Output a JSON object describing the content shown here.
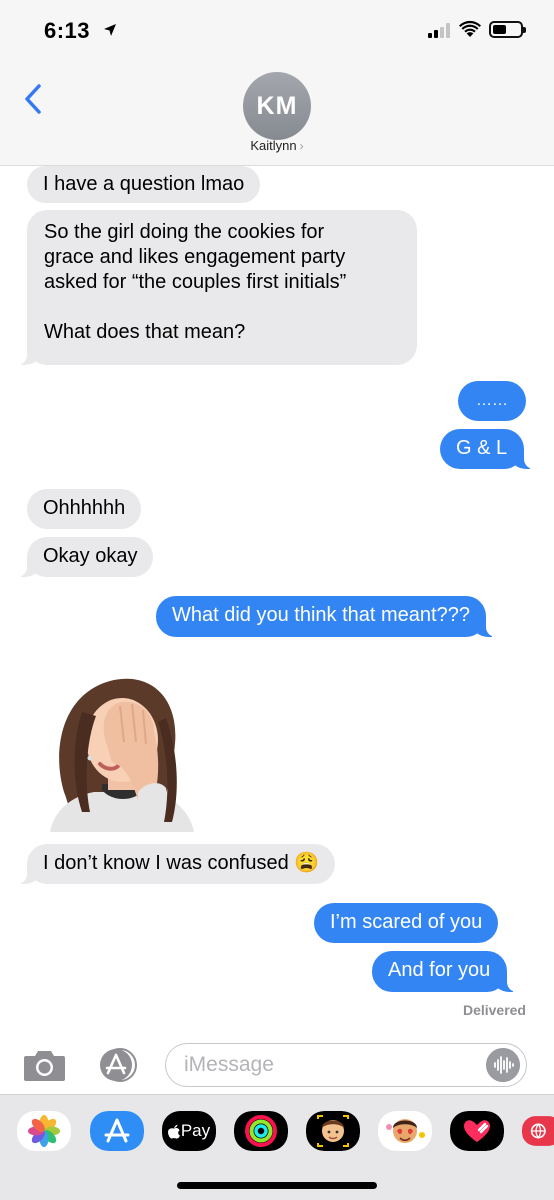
{
  "status_bar": {
    "time": "6:13"
  },
  "header": {
    "avatar_initials": "KM",
    "contact_name": "Kaitlynn",
    "chevron": "›"
  },
  "messages": [
    {
      "from": "them",
      "text": "I have a question lmao"
    },
    {
      "from": "them",
      "lines": [
        "So the girl doing the cookies for",
        "grace and likes engagement party",
        "asked for “the couples first initials”",
        "",
        "What does that mean?"
      ]
    },
    {
      "from": "me",
      "text": "……"
    },
    {
      "from": "me",
      "text": "G & L"
    },
    {
      "from": "them",
      "text": "Ohhhhhh"
    },
    {
      "from": "them",
      "text": "Okay okay"
    },
    {
      "from": "me",
      "text": "What did you think that meant???"
    },
    {
      "from": "them",
      "type": "memoji-sticker",
      "icon": "facepalm-memoji"
    },
    {
      "from": "them",
      "text": "I don’t know I was confused 😩"
    },
    {
      "from": "me",
      "text": "I’m scared of you"
    },
    {
      "from": "me",
      "text": "And for you"
    }
  ],
  "delivered_label": "Delivered",
  "composer": {
    "placeholder": "iMessage"
  },
  "app_drawer": [
    {
      "name": "photos",
      "icon": "photos-icon"
    },
    {
      "name": "app-store",
      "icon": "app-store-icon"
    },
    {
      "name": "apple-pay",
      "label": "Pay",
      "icon": "apple-pay-icon"
    },
    {
      "name": "activity",
      "icon": "activity-rings-icon"
    },
    {
      "name": "memoji",
      "icon": "memoji-icon"
    },
    {
      "name": "memoji-stickers",
      "icon": "memoji-stickers-icon"
    },
    {
      "name": "digital-touch",
      "icon": "heart-touch-icon"
    },
    {
      "name": "web-search",
      "icon": "globe-search-icon"
    }
  ],
  "colors": {
    "outgoing": "#3485f4",
    "incoming": "#e9e9eb",
    "accent": "#3478f6"
  }
}
